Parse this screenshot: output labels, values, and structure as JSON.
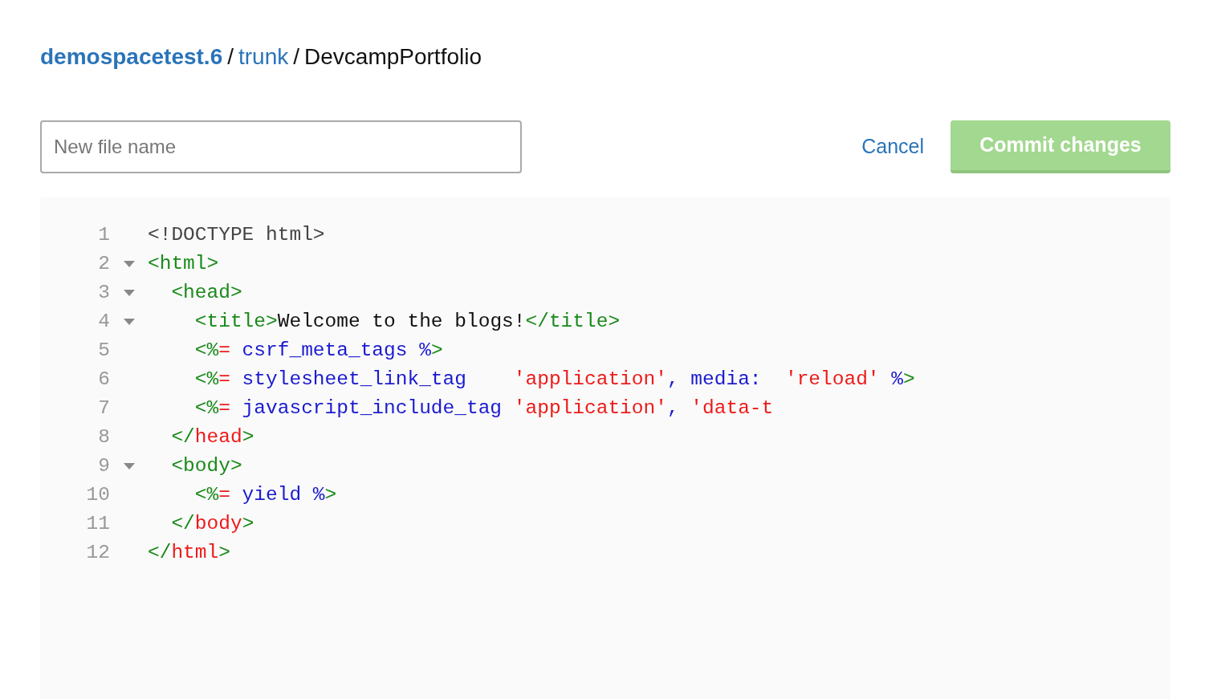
{
  "breadcrumb": [
    {
      "text": "demospacetest.6",
      "kind": "space"
    },
    {
      "text": "/",
      "kind": "sep"
    },
    {
      "text": "trunk",
      "kind": "link"
    },
    {
      "text": "/",
      "kind": "sep"
    },
    {
      "text": "DevcampPortfolio",
      "kind": "current"
    }
  ],
  "filename": {
    "placeholder": "New file name"
  },
  "actions": {
    "cancel": "Cancel",
    "commit": {
      "label": "Commit changes",
      "disabled": true
    }
  },
  "editor": {
    "lines": [
      {
        "number": "1",
        "kind": "plain",
        "tokens": [
          {
            "text": "<!DOCTYPE html>",
            "kind": "doctype"
          }
        ]
      },
      {
        "number": "2",
        "kind": "fold",
        "tokens": [
          {
            "text": "<html>",
            "kind": "tag"
          }
        ]
      },
      {
        "number": "3",
        "kind": "fold",
        "tokens": [
          {
            "text": "  <head>",
            "kind": "tag"
          }
        ]
      },
      {
        "number": "4",
        "kind": "fold",
        "tokens": [
          {
            "text": "    <title>",
            "kind": "tag"
          },
          {
            "text": "Welcome to the blogs!",
            "kind": "text"
          },
          {
            "text": "</title>",
            "kind": "tag"
          }
        ]
      },
      {
        "number": "5",
        "kind": "plain",
        "tokens": [
          {
            "text": "    <%",
            "kind": "tag"
          },
          {
            "text": "=",
            "kind": "str"
          },
          {
            "text": " csrf_meta_tags %",
            "kind": "kw"
          },
          {
            "text": ">",
            "kind": "tag"
          }
        ]
      },
      {
        "number": "6",
        "kind": "plain",
        "tokens": [
          {
            "text": "    <%",
            "kind": "tag"
          },
          {
            "text": "=",
            "kind": "str"
          },
          {
            "text": " stylesheet_link_tag    ",
            "kind": "kw"
          },
          {
            "text": "'application'",
            "kind": "str"
          },
          {
            "text": ", media:  ",
            "kind": "kw"
          },
          {
            "text": "'reload'",
            "kind": "str"
          },
          {
            "text": " %",
            "kind": "kw"
          },
          {
            "text": ">",
            "kind": "tag"
          }
        ]
      },
      {
        "number": "7",
        "kind": "plain",
        "tokens": [
          {
            "text": "    <%",
            "kind": "tag"
          },
          {
            "text": "=",
            "kind": "str"
          },
          {
            "text": " javascript_include_tag ",
            "kind": "kw"
          },
          {
            "text": "'application'",
            "kind": "str"
          },
          {
            "text": ", ",
            "kind": "kw"
          },
          {
            "text": "'data-t",
            "kind": "str"
          }
        ]
      },
      {
        "number": "8",
        "kind": "plain",
        "tokens": [
          {
            "text": "  </",
            "kind": "tag"
          },
          {
            "text": "head",
            "kind": "str"
          },
          {
            "text": ">",
            "kind": "tag"
          }
        ]
      },
      {
        "number": "9",
        "kind": "fold",
        "tokens": [
          {
            "text": "  <body>",
            "kind": "tag"
          }
        ]
      },
      {
        "number": "10",
        "kind": "plain",
        "tokens": [
          {
            "text": "    <%",
            "kind": "tag"
          },
          {
            "text": "=",
            "kind": "str"
          },
          {
            "text": " yield %",
            "kind": "kw"
          },
          {
            "text": ">",
            "kind": "tag"
          }
        ]
      },
      {
        "number": "11",
        "kind": "plain",
        "tokens": [
          {
            "text": "  </",
            "kind": "tag"
          },
          {
            "text": "body",
            "kind": "str"
          },
          {
            "text": ">",
            "kind": "tag"
          }
        ]
      },
      {
        "number": "12",
        "kind": "plain",
        "tokens": [
          {
            "text": "</",
            "kind": "tag"
          },
          {
            "text": "html",
            "kind": "str"
          },
          {
            "text": ">",
            "kind": "tag"
          }
        ]
      }
    ]
  }
}
